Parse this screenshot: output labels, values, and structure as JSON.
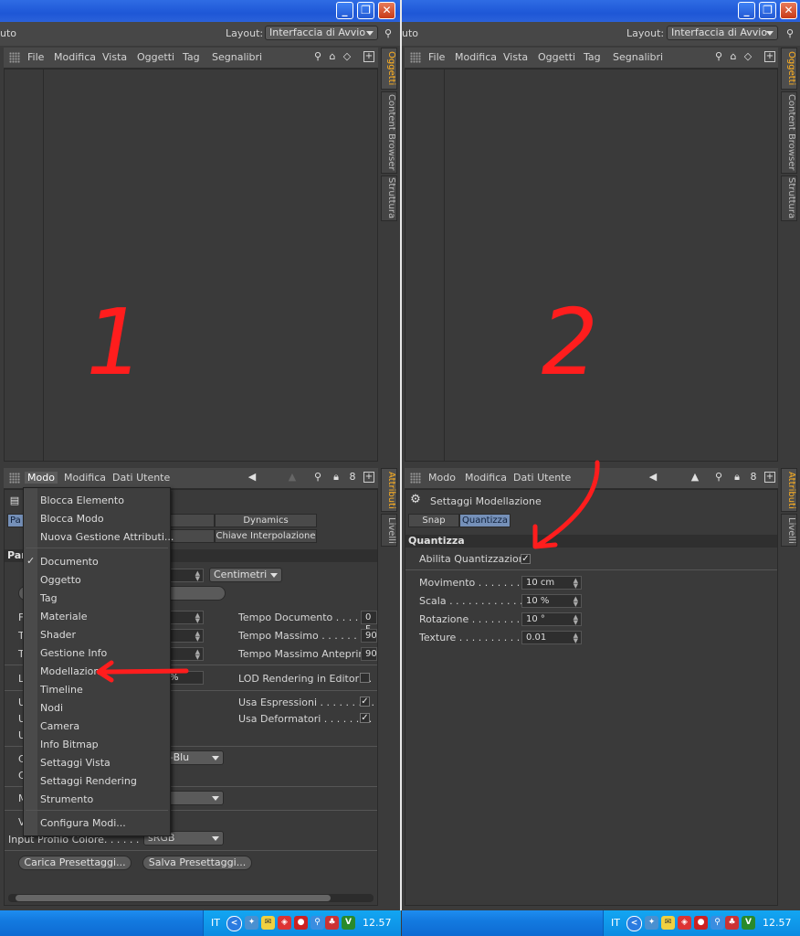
{
  "left": {
    "title_partial": "uto",
    "layout_label": "Layout:",
    "layout_value": "Interfaccia di Avvio",
    "menu": [
      "File",
      "Modifica",
      "Vista",
      "Oggetti",
      "Tag",
      "Segnalibri"
    ],
    "side_tabs_top": [
      "Oggetti",
      "Content Browser",
      "Struttura"
    ],
    "annotation": "1",
    "attr_menu": [
      "Modo",
      "Modifica",
      "Dati Utente"
    ],
    "side_tabs_bottom": [
      "Attributi",
      "Livelli"
    ],
    "section_partial": "Par",
    "tabs_partial": [
      "Pa",
      "Dynamics",
      "Chiave Interpolazione"
    ],
    "units_value": "Centimetri",
    "right_props": [
      {
        "label": "Tempo Documento . . . . . .",
        "value": "0 F"
      },
      {
        "label": "Tempo Massimo . . . . . . . . .",
        "value": "90"
      },
      {
        "label": "Tempo Massimo Anteprima",
        "value": "90"
      }
    ],
    "lod_label": "LOD Rendering in Editor . .",
    "expr_label": "Usa Espressioni . . . . . . . . .",
    "deform_label": "Usa Deformatori . . . . . . . .",
    "partial_pct": "%",
    "partial_blu": "-Blu",
    "input_profile_label": "Input Profilo Colore. . . . . .",
    "input_profile_value": "sRGB",
    "load_btn": "Carica Presettaggi...",
    "save_btn": "Salva Presettaggi...",
    "left_letters": [
      "F",
      "T",
      "T",
      "L",
      "U",
      "U",
      "U",
      "C",
      "C",
      "M",
      "V"
    ],
    "dropdown": [
      "Blocca Elemento",
      "Blocca Modo",
      "Nuova Gestione Attributi...",
      "Documento",
      "Oggetto",
      "Tag",
      "Materiale",
      "Shader",
      "Gestione Info",
      "Modellazione",
      "Timeline",
      "Nodi",
      "Camera",
      "Info Bitmap",
      "Settaggi Vista",
      "Settaggi Rendering",
      "Strumento",
      "Configura Modi..."
    ]
  },
  "right": {
    "title_partial": "uto",
    "layout_label": "Layout:",
    "layout_value": "Interfaccia di Avvio",
    "menu": [
      "File",
      "Modifica",
      "Vista",
      "Oggetti",
      "Tag",
      "Segnalibri"
    ],
    "side_tabs_top": [
      "Oggetti",
      "Content Browser",
      "Struttura"
    ],
    "annotation": "2",
    "attr_menu": [
      "Modo",
      "Modifica",
      "Dati Utente"
    ],
    "side_tabs_bottom": [
      "Attributi",
      "Livelli"
    ],
    "settings_title": "Settaggi Modellazione",
    "tabs": [
      "Snap",
      "Quantizza"
    ],
    "section": "Quantizza",
    "enable_label": "Abilita Quantizzazione",
    "props": [
      {
        "label": "Movimento . . . . . . . .",
        "value": "10 cm"
      },
      {
        "label": "Scala . . . . . . . . . . . . . .",
        "value": "10 %"
      },
      {
        "label": "Rotazione . . . . . . . . .",
        "value": "10 °"
      },
      {
        "label": "Texture . . . . . . . . . . .",
        "value": "0.01"
      }
    ]
  },
  "taskbar": {
    "lang": "IT",
    "clock": "12.57"
  },
  "colors": {
    "annotation_red": "#ff1d1d",
    "active_tab_orange": "#ffb020",
    "selected_tab_blue": "#7590b8"
  }
}
